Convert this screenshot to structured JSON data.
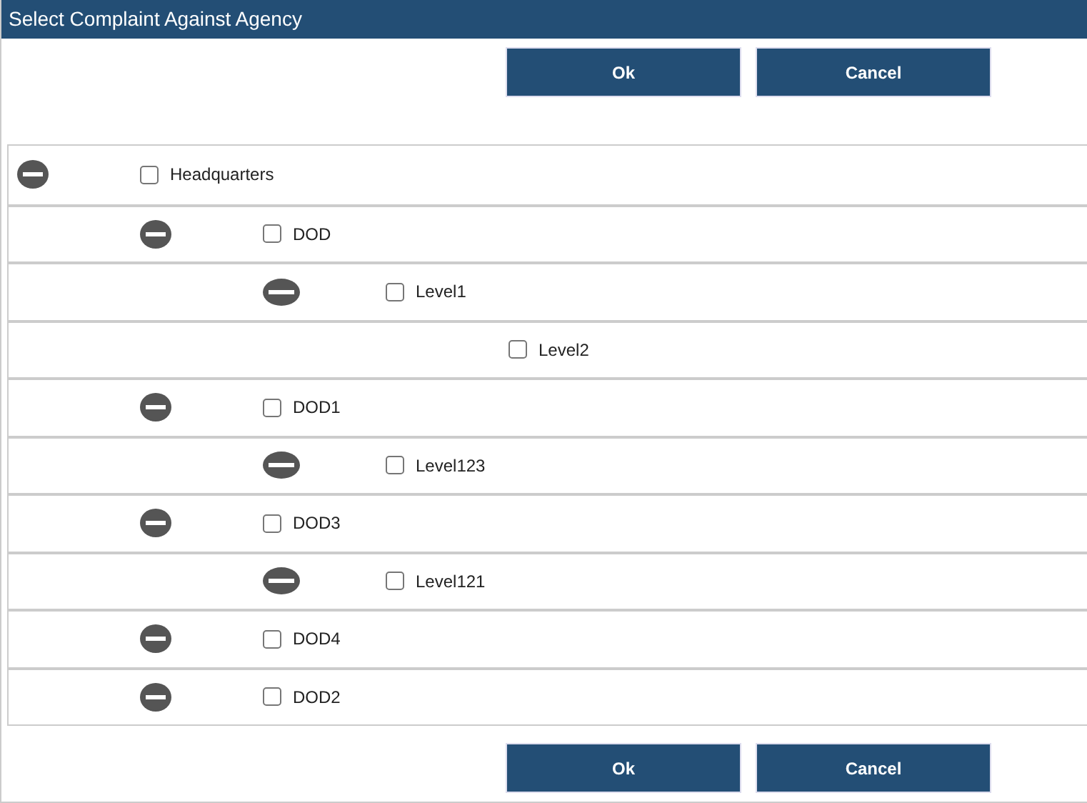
{
  "window": {
    "title": "Select Complaint Against Agency"
  },
  "top_buttons": [
    "Ok",
    "Cancel"
  ],
  "tree": [
    {
      "label": "Headquarters",
      "checked": false,
      "expanded": true,
      "children": [
        {
          "label": "DOD",
          "checked": false,
          "expanded": true,
          "children": [
            {
              "label": "Level1",
              "checked": false,
              "expanded": true,
              "children": [
                {
                  "label": "Level2",
                  "checked": false
                }
              ]
            }
          ]
        },
        {
          "label": "DOD1",
          "checked": false,
          "expanded": true,
          "children": [
            {
              "label": "Level123",
              "checked": false,
              "expanded": true
            }
          ]
        },
        {
          "label": "DOD3",
          "checked": false,
          "expanded": true,
          "children": [
            {
              "label": "Level121",
              "checked": false,
              "expanded": true
            }
          ]
        },
        {
          "label": "DOD4",
          "checked": false,
          "expanded": true
        },
        {
          "label": "DOD2",
          "checked": false,
          "expanded": true
        }
      ]
    }
  ],
  "bottom_buttons": [
    "Ok",
    "Cancel"
  ]
}
